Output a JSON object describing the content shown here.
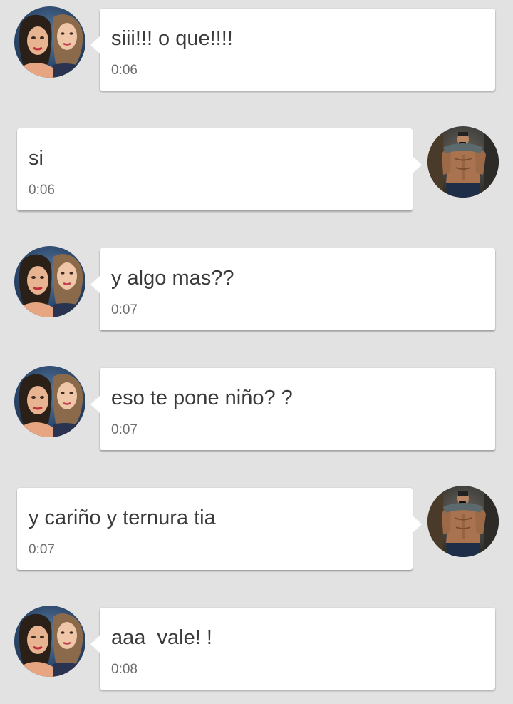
{
  "messages": [
    {
      "sender": "contact",
      "text": "siii!!! o que!!!!",
      "time": "0:06"
    },
    {
      "sender": "me",
      "text": "si",
      "time": "0:06"
    },
    {
      "sender": "contact",
      "text": "y algo mas??",
      "time": "0:07"
    },
    {
      "sender": "contact",
      "text": "eso te pone niño? ?",
      "time": "0:07"
    },
    {
      "sender": "me",
      "text": "y cariño y ternura tia",
      "time": "0:07"
    },
    {
      "sender": "contact",
      "text": "aaa  vale! !",
      "time": "0:08"
    }
  ],
  "colors": {
    "background": "#e3e2e3",
    "bubble": "#ffffff",
    "text": "#3a3a3a",
    "timestamp": "#6e6e6e"
  },
  "icons": {
    "contact_avatar": "contact-avatar-photo",
    "my_avatar": "my-avatar-photo"
  }
}
